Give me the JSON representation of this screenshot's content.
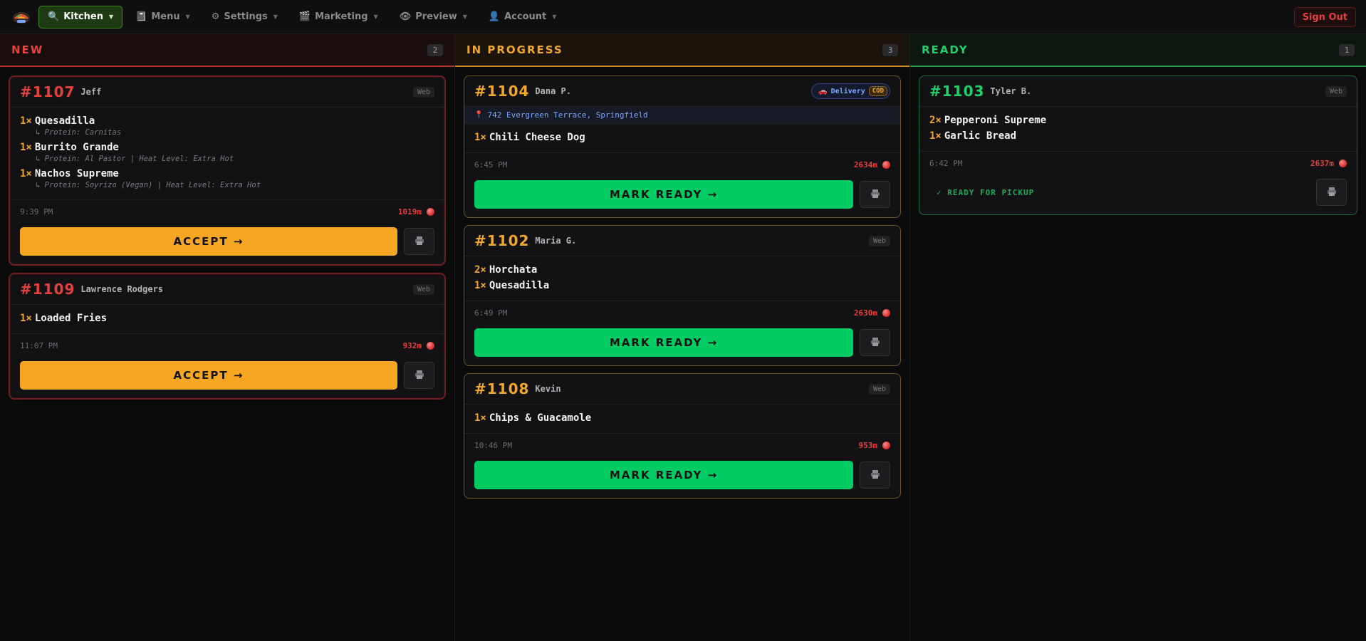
{
  "nav": {
    "items": [
      {
        "label": "Kitchen",
        "icon": "magnifier-icon",
        "glyph": "🔍",
        "active": true
      },
      {
        "label": "Menu",
        "icon": "book-icon",
        "glyph": "📓",
        "active": false
      },
      {
        "label": "Settings",
        "icon": "gear-icon",
        "glyph": "⚙",
        "active": false
      },
      {
        "label": "Marketing",
        "icon": "clapperboard-icon",
        "glyph": "🎬",
        "active": false
      },
      {
        "label": "Preview",
        "icon": "eye-icon",
        "glyph": "👁",
        "active": false
      },
      {
        "label": "Account",
        "icon": "user-icon",
        "glyph": "👤",
        "active": false
      }
    ],
    "signout": "Sign Out",
    "colors": {
      "active_bg": "#1d3a12",
      "active_border": "#3f8a22",
      "signout": "#e0413e"
    }
  },
  "columns": [
    {
      "key": "new",
      "title": "NEW",
      "count": "2",
      "color": "#e5413d",
      "orders": [
        {
          "number": "#1107",
          "customer": "Jeff",
          "source": "Web",
          "items": [
            {
              "qty": "1×",
              "name": "Quesadilla",
              "mod": "↳ Protein: Carnitas"
            },
            {
              "qty": "1×",
              "name": "Burrito Grande",
              "mod": "↳ Protein: Al Pastor | Heat Level: Extra Hot"
            },
            {
              "qty": "1×",
              "name": "Nachos Supreme",
              "mod": "↳ Protein: Soyrizo (Vegan) | Heat Level: Extra Hot"
            }
          ],
          "time": "9:39 PM",
          "age": "1019m",
          "action": "ACCEPT →"
        },
        {
          "number": "#1109",
          "customer": "Lawrence Rodgers",
          "source": "Web",
          "items": [
            {
              "qty": "1×",
              "name": "Loaded Fries",
              "mod": ""
            }
          ],
          "time": "11:07 PM",
          "age": "932m",
          "action": "ACCEPT →"
        }
      ]
    },
    {
      "key": "prog",
      "title": "IN PROGRESS",
      "count": "3",
      "color": "#f1a72a",
      "orders": [
        {
          "number": "#1104",
          "customer": "Dana P.",
          "source": "",
          "delivery": {
            "label": "Delivery",
            "tag": "COD",
            "icon": "car-icon",
            "glyph": "🚗"
          },
          "address": "742 Evergreen Terrace, Springfield",
          "items": [
            {
              "qty": "1×",
              "name": "Chili Cheese Dog",
              "mod": ""
            }
          ],
          "time": "6:45 PM",
          "age": "2634m",
          "action": "MARK READY →"
        },
        {
          "number": "#1102",
          "customer": "Maria G.",
          "source": "Web",
          "items": [
            {
              "qty": "2×",
              "name": "Horchata",
              "mod": ""
            },
            {
              "qty": "1×",
              "name": "Quesadilla",
              "mod": ""
            }
          ],
          "time": "6:49 PM",
          "age": "2630m",
          "action": "MARK READY →"
        },
        {
          "number": "#1108",
          "customer": "Kevin",
          "source": "Web",
          "items": [
            {
              "qty": "1×",
              "name": "Chips & Guacamole",
              "mod": ""
            }
          ],
          "time": "10:46 PM",
          "age": "953m",
          "action": "MARK READY →"
        }
      ]
    },
    {
      "key": "ready",
      "title": "READY",
      "count": "1",
      "color": "#1fd16a",
      "orders": [
        {
          "number": "#1103",
          "customer": "Tyler B.",
          "source": "Web",
          "items": [
            {
              "qty": "2×",
              "name": "Pepperoni Supreme",
              "mod": ""
            },
            {
              "qty": "1×",
              "name": "Garlic Bread",
              "mod": ""
            }
          ],
          "time": "6:42 PM",
          "age": "2637m",
          "status": "✓ READY FOR PICKUP"
        }
      ]
    }
  ]
}
